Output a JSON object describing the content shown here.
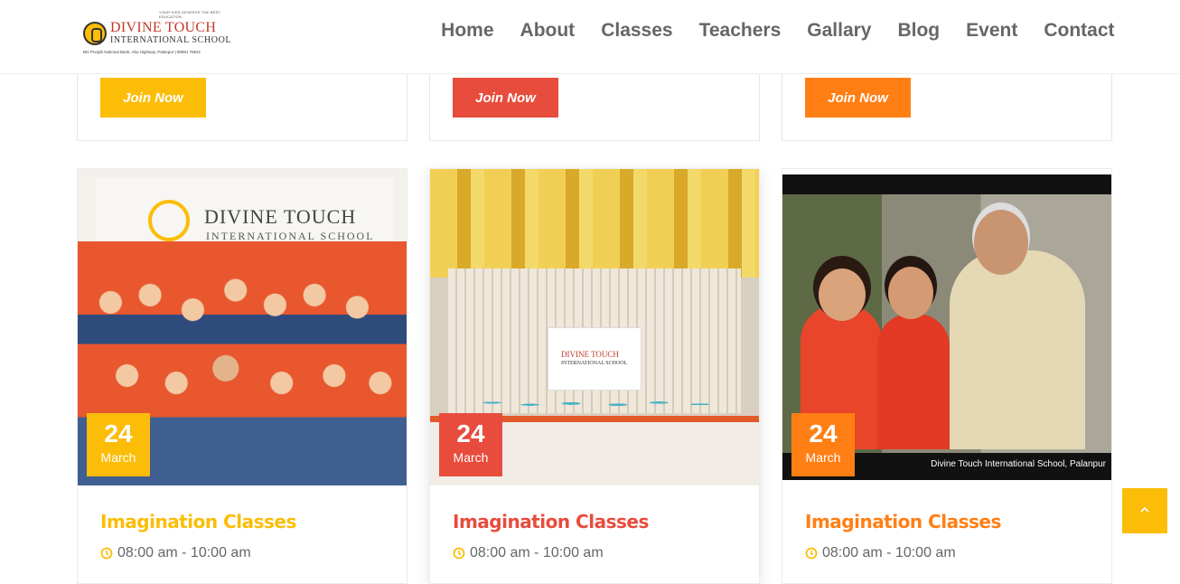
{
  "header": {
    "logo": {
      "tagline": "YOUR KIDS DESERVE THE BEST EDUCATION",
      "name": "DIVINE TOUCH",
      "sub": "INTERNATIONAL SCHOOL",
      "address": "Bh/ Punjab National Bank, Abu Highway, Palanpur | 98981 78621"
    },
    "nav": [
      "Home",
      "About",
      "Classes",
      "Teachers",
      "Gallary",
      "Blog",
      "Event",
      "Contact"
    ]
  },
  "top_cards": [
    {
      "button": "Join Now",
      "color": "#fbbd08"
    },
    {
      "button": "Join Now",
      "color": "#e74c3c"
    },
    {
      "button": "Join Now",
      "color": "#ff7f15"
    }
  ],
  "events": [
    {
      "day": "24",
      "month": "March",
      "title": "Imagination Classes",
      "time": "08:00 am - 10:00 am",
      "accent": "#fbbd08",
      "photo": {
        "sign_name": "DIVINE TOUCH",
        "sign_sub": "INTERNATIONAL SCHOOL"
      }
    },
    {
      "day": "24",
      "month": "March",
      "title": "Imagination Classes",
      "time": "08:00 am - 10:00 am",
      "accent": "#e74c3c",
      "photo": {
        "sign_name": "DIVINE TOUCH",
        "sign_sub": "INTERNATIONAL SCHOOL"
      }
    },
    {
      "day": "24",
      "month": "March",
      "title": "Imagination Classes",
      "time": "08:00 am - 10:00 am",
      "accent": "#ff7f15",
      "photo": {
        "caption": "Divine Touch International School, Palanpur"
      }
    }
  ],
  "scroll_top": {
    "icon": "chevron-up-icon",
    "color": "#fbbd08"
  }
}
